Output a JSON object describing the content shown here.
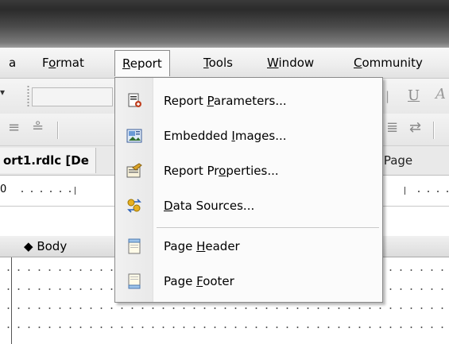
{
  "menubar": {
    "items": [
      {
        "label": "a"
      },
      {
        "label": "Format"
      },
      {
        "label": "Report"
      },
      {
        "label": "Tools"
      },
      {
        "label": "Window"
      },
      {
        "label": "Community"
      }
    ]
  },
  "document": {
    "tab_title": "ort1.rdlc [De",
    "tab_right": "rt Page",
    "ruler_start": "0",
    "section_label": "Body"
  },
  "report_menu": {
    "items": [
      {
        "label": "Report Parameters...",
        "icon": "report-parameters-icon"
      },
      {
        "label": "Embedded Images...",
        "icon": "embedded-images-icon"
      },
      {
        "label": "Report Properties...",
        "icon": "report-properties-icon"
      },
      {
        "label": "Data Sources...",
        "icon": "data-sources-icon"
      },
      {
        "label": "Page Header",
        "icon": "page-header-icon"
      },
      {
        "label": "Page Footer",
        "icon": "page-footer-icon"
      }
    ]
  },
  "toolbar": {
    "underline_glyph": "U",
    "font_glyph": "A"
  }
}
